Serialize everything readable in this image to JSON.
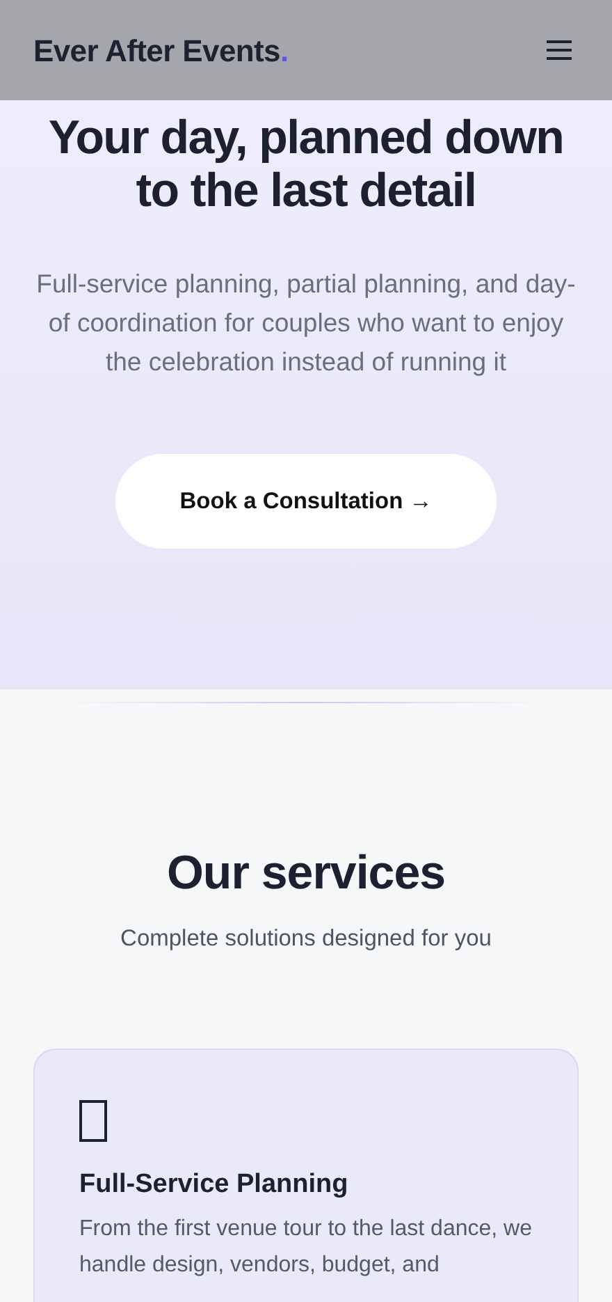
{
  "navbar": {
    "brand": "Ever After Events",
    "brand_accent": "."
  },
  "hero": {
    "title": "Your day, planned down to the last detail",
    "subtitle": "Full-service planning, partial planning, and day-of coordination for couples who want to enjoy the celebration instead of running it",
    "cta": "Book a Consultation →"
  },
  "services": {
    "title": "Our services",
    "subtitle": "Complete solutions designed for you",
    "cards": [
      {
        "title": "Full-Service Planning",
        "text": "From the first venue tour to the last dance, we handle design, vendors, budget, and"
      }
    ]
  }
}
